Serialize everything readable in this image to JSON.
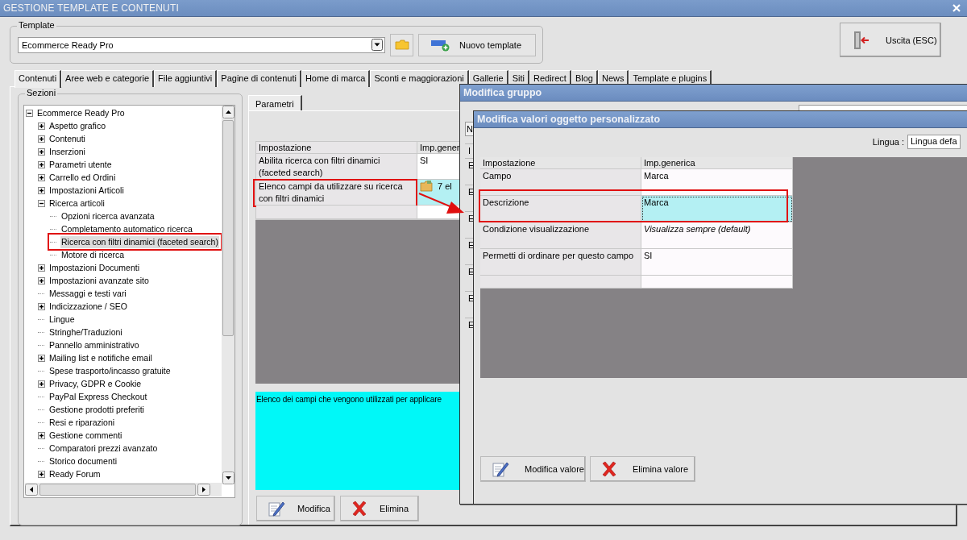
{
  "window": {
    "title": "GESTIONE TEMPLATE E CONTENUTI"
  },
  "template": {
    "label": "Template",
    "value": "Ecommerce Ready Pro",
    "new_button": "Nuovo template"
  },
  "exit_button": "Uscita (ESC)",
  "tabs": [
    {
      "label": "Contenuti",
      "selected": true
    },
    {
      "label": "Aree web e categorie",
      "selected": false
    },
    {
      "label": "File aggiuntivi",
      "selected": false
    },
    {
      "label": "Pagine di contenuti",
      "selected": false
    },
    {
      "label": "Home di marca",
      "selected": false
    },
    {
      "label": "Sconti e maggiorazioni",
      "selected": false
    },
    {
      "label": "Gallerie",
      "selected": false
    },
    {
      "label": "Siti",
      "selected": false
    },
    {
      "label": "Redirect",
      "selected": false
    },
    {
      "label": "Blog",
      "selected": false
    },
    {
      "label": "News",
      "selected": false
    },
    {
      "label": "Template e plugins",
      "selected": false
    }
  ],
  "sections": {
    "label": "Sezioni",
    "tree": [
      {
        "label": "Ecommerce Ready Pro",
        "expandable": true,
        "expanded": true,
        "selected": false,
        "annotated": false,
        "children": [
          {
            "label": "Aspetto grafico",
            "expandable": true,
            "expanded": false,
            "selected": false,
            "annotated": false
          },
          {
            "label": "Contenuti",
            "expandable": true,
            "expanded": false,
            "selected": false,
            "annotated": false
          },
          {
            "label": "Inserzioni",
            "expandable": true,
            "expanded": false,
            "selected": false,
            "annotated": false
          },
          {
            "label": "Parametri utente",
            "expandable": true,
            "expanded": false,
            "selected": false,
            "annotated": false
          },
          {
            "label": "Carrello ed Ordini",
            "expandable": true,
            "expanded": false,
            "selected": false,
            "annotated": false
          },
          {
            "label": "Impostazioni Articoli",
            "expandable": true,
            "expanded": false,
            "selected": false,
            "annotated": false
          },
          {
            "label": "Ricerca articoli",
            "expandable": true,
            "expanded": true,
            "selected": false,
            "annotated": false,
            "children": [
              {
                "label": "Opzioni ricerca avanzata",
                "expandable": false,
                "selected": false,
                "annotated": false
              },
              {
                "label": "Completamento automatico ricerca",
                "expandable": false,
                "selected": false,
                "annotated": false
              },
              {
                "label": "Ricerca con filtri dinamici (faceted search)",
                "expandable": false,
                "selected": true,
                "annotated": true
              },
              {
                "label": "Motore di ricerca",
                "expandable": false,
                "selected": false,
                "annotated": false
              }
            ]
          },
          {
            "label": "Impostazioni Documenti",
            "expandable": true,
            "expanded": false,
            "selected": false,
            "annotated": false
          },
          {
            "label": "Impostazioni avanzate sito",
            "expandable": true,
            "expanded": false,
            "selected": false,
            "annotated": false
          },
          {
            "label": "Messaggi e testi vari",
            "expandable": false,
            "selected": false,
            "annotated": false
          },
          {
            "label": "Indicizzazione / SEO",
            "expandable": true,
            "expanded": false,
            "selected": false,
            "annotated": false
          },
          {
            "label": "Lingue",
            "expandable": false,
            "selected": false,
            "annotated": false
          },
          {
            "label": "Stringhe/Traduzioni",
            "expandable": false,
            "selected": false,
            "annotated": false
          },
          {
            "label": "Pannello amministrativo",
            "expandable": false,
            "selected": false,
            "annotated": false
          },
          {
            "label": "Mailing list e notifiche email",
            "expandable": true,
            "expanded": false,
            "selected": false,
            "annotated": false
          },
          {
            "label": "Spese trasporto/incasso gratuite",
            "expandable": false,
            "selected": false,
            "annotated": false
          },
          {
            "label": "Privacy, GDPR e Cookie",
            "expandable": true,
            "expanded": false,
            "selected": false,
            "annotated": false
          },
          {
            "label": "PayPal Express Checkout",
            "expandable": false,
            "selected": false,
            "annotated": false
          },
          {
            "label": "Gestione prodotti preferiti",
            "expandable": false,
            "selected": false,
            "annotated": false
          },
          {
            "label": "Resi e riparazioni",
            "expandable": false,
            "selected": false,
            "annotated": false
          },
          {
            "label": "Gestione commenti",
            "expandable": true,
            "expanded": false,
            "selected": false,
            "annotated": false
          },
          {
            "label": "Comparatori prezzi avanzato",
            "expandable": false,
            "selected": false,
            "annotated": false
          },
          {
            "label": "Storico documenti",
            "expandable": false,
            "selected": false,
            "annotated": false
          },
          {
            "label": "Ready Forum",
            "expandable": true,
            "expanded": false,
            "selected": false,
            "annotated": false
          }
        ]
      }
    ]
  },
  "parameters": {
    "tabs": [
      {
        "label": "Parametri",
        "selected": true
      }
    ],
    "table": {
      "columns": [
        "Impostazione",
        "Imp.gener"
      ],
      "rows": [
        {
          "cells": [
            "Abilita ricerca con filtri dinamici (faceted search)",
            "SI"
          ],
          "folder": false,
          "selected": false,
          "annotated": false
        },
        {
          "cells": [
            "Elenco campi da utilizzare su ricerca con filtri dinamici",
            "7 el"
          ],
          "folder": true,
          "selected": true,
          "annotated": true
        }
      ]
    },
    "description": "Elenco dei campi che vengono utilizzati per applicare",
    "buttons": [
      {
        "label": "Modifica",
        "kind": "edit"
      },
      {
        "label": "Elimina",
        "kind": "delete"
      }
    ]
  },
  "group_dialog": {
    "title": "Modifica gruppo",
    "column_1": {
      "header": "N",
      "table_header": "I",
      "rows": [
        "E",
        "E",
        "E",
        "E",
        "E",
        "E",
        "E"
      ]
    }
  },
  "value_dialog": {
    "title": "Modifica valori oggetto personalizzato",
    "language": {
      "label": "Lingua :",
      "value": "Lingua defa"
    },
    "table": {
      "columns": [
        "Impostazione",
        "Imp.generica"
      ],
      "rows": [
        {
          "cells": [
            "Campo",
            "Marca"
          ],
          "is_default": false,
          "selected": false,
          "annotated": false
        },
        {
          "cells": [
            "Descrizione",
            "Marca"
          ],
          "is_default": false,
          "selected": true,
          "annotated": true
        },
        {
          "cells": [
            "Condizione visualizzazione",
            "Visualizza sempre (default)"
          ],
          "is_default": true,
          "selected": false,
          "annotated": false
        },
        {
          "cells": [
            "Permetti di ordinare per questo campo",
            "SI"
          ],
          "is_default": false,
          "selected": false,
          "annotated": false
        }
      ]
    },
    "buttons": [
      {
        "label": "Modifica valore",
        "kind": "edit"
      },
      {
        "label": "Elimina valore",
        "kind": "delete"
      }
    ]
  }
}
